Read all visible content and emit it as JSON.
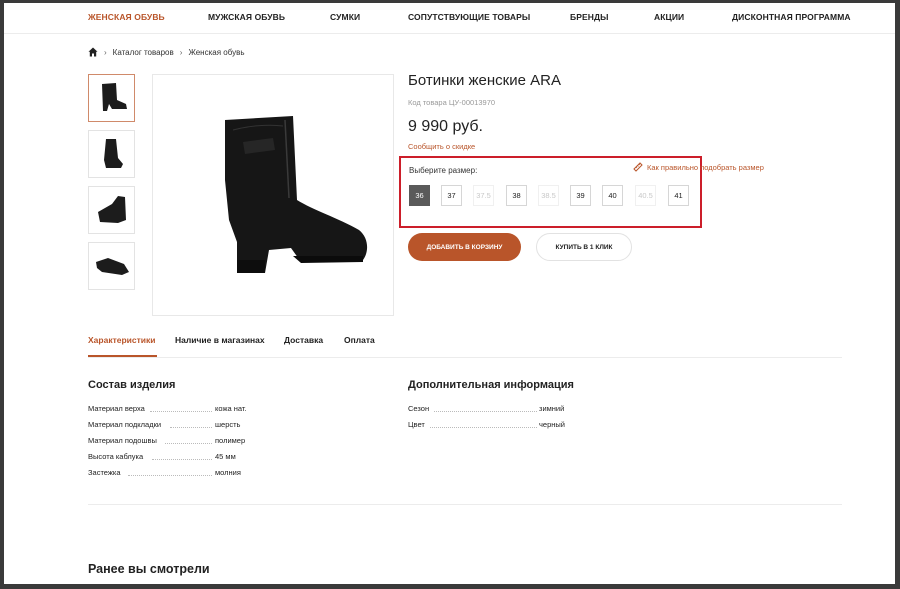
{
  "nav": {
    "items": [
      "Женская обувь",
      "Мужская обувь",
      "Сумки",
      "Сопутствующие товары",
      "Бренды",
      "Акции",
      "Дисконтная программа"
    ],
    "active_index": 0
  },
  "breadcrumb": {
    "icon": "home-icon",
    "items": [
      "Каталог товаров",
      "Женская обувь"
    ]
  },
  "product": {
    "title": "Ботинки женские ARA",
    "sku": "Код товара ЦУ-00013970",
    "price": "9 990 руб.",
    "discount_link": "Сообщить о скидке",
    "size_label": "Выберите размер:",
    "size_guide": "Как правильно подобрать размер",
    "sizes": [
      {
        "value": "36",
        "state": "selected"
      },
      {
        "value": "37",
        "state": "available"
      },
      {
        "value": "37.5",
        "state": "disabled"
      },
      {
        "value": "38",
        "state": "available"
      },
      {
        "value": "38.5",
        "state": "disabled"
      },
      {
        "value": "39",
        "state": "available"
      },
      {
        "value": "40",
        "state": "available"
      },
      {
        "value": "40.5",
        "state": "disabled"
      },
      {
        "value": "41",
        "state": "available"
      }
    ],
    "add_to_cart": "ДОБАВИТЬ В КОРЗИНУ",
    "buy_one_click": "КУПИТЬ В 1 КЛИК"
  },
  "tabs": {
    "items": [
      "Характеристики",
      "Наличие в магазинах",
      "Доставка",
      "Оплата"
    ],
    "active_index": 0
  },
  "composition": {
    "heading": "Состав изделия",
    "rows": [
      {
        "key": "Материал верха",
        "value": "кожа нат."
      },
      {
        "key": "Материал подкладки",
        "value": "шерсть"
      },
      {
        "key": "Материал подошвы",
        "value": "полимер"
      },
      {
        "key": "Высота каблука",
        "value": "45 мм"
      },
      {
        "key": "Застежка",
        "value": "молния"
      }
    ]
  },
  "extra": {
    "heading": "Дополнительная информация",
    "rows": [
      {
        "key": "Сезон",
        "value": "зимний"
      },
      {
        "key": "Цвет",
        "value": "черный"
      }
    ]
  },
  "recently_viewed": "Ранее вы смотрели",
  "colors": {
    "accent": "#b9552a",
    "highlight_box": "#cc1e2a",
    "selected_size": "#5a5a5a"
  }
}
